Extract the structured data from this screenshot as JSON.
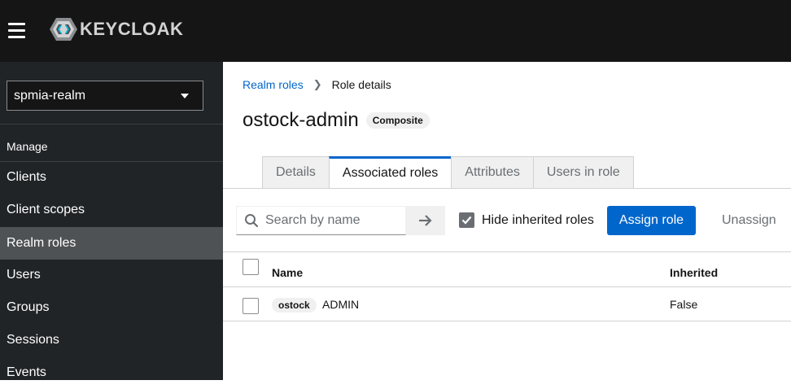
{
  "header": {
    "logo_text": "KEYCLOAK",
    "menu_icon": "hamburger-menu-icon"
  },
  "sidebar": {
    "realm": "spmia-realm",
    "group_label": "Manage",
    "items": [
      {
        "label": "Clients",
        "active": false
      },
      {
        "label": "Client scopes",
        "active": false
      },
      {
        "label": "Realm roles",
        "active": true
      },
      {
        "label": "Users",
        "active": false
      },
      {
        "label": "Groups",
        "active": false
      },
      {
        "label": "Sessions",
        "active": false
      },
      {
        "label": "Events",
        "active": false
      }
    ]
  },
  "breadcrumb": {
    "parent": "Realm roles",
    "current": "Role details"
  },
  "page": {
    "title": "ostock-admin",
    "badge": "Composite"
  },
  "tabs": [
    {
      "label": "Details",
      "active": false
    },
    {
      "label": "Associated roles",
      "active": true
    },
    {
      "label": "Attributes",
      "active": false
    },
    {
      "label": "Users in role",
      "active": false
    }
  ],
  "toolbar": {
    "search_placeholder": "Search by name",
    "hide_inherited_label": "Hide inherited roles",
    "hide_inherited_checked": true,
    "assign_label": "Assign role",
    "unassign_label": "Unassign"
  },
  "table": {
    "columns": [
      "Name",
      "Inherited"
    ],
    "rows": [
      {
        "client": "ostock",
        "name": "ADMIN",
        "inherited": "False"
      }
    ]
  },
  "colors": {
    "accent": "#0066cc",
    "header_bg": "#151515",
    "sidebar_bg": "#212427",
    "sidebar_active": "#4f5255"
  }
}
